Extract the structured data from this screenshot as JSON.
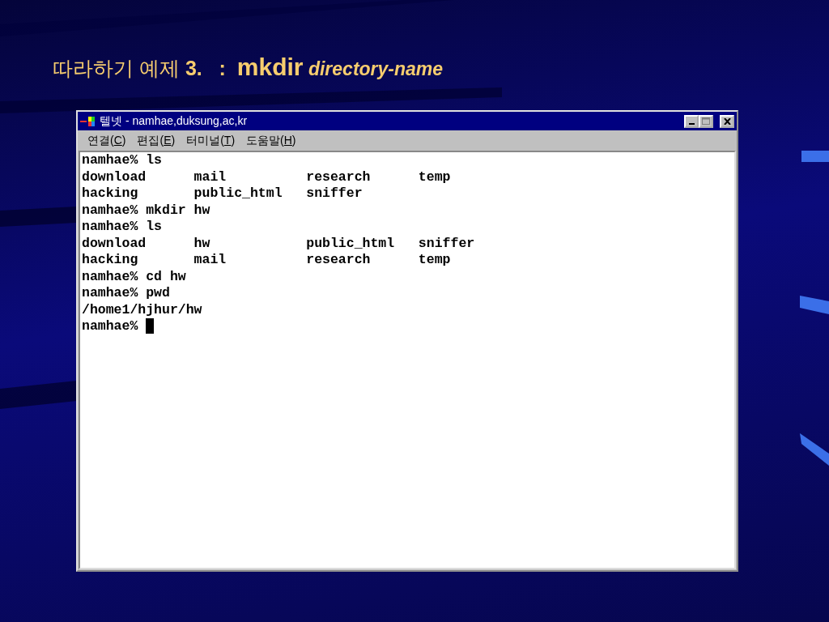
{
  "slide_title": [
    {
      "text": "따라하기 예제 ",
      "kind": "plain"
    },
    {
      "text": "3.   :  ",
      "kind": "bold"
    },
    {
      "text": "mkdir",
      "kind": "command"
    },
    {
      "text": " directory-name",
      "kind": "italic"
    }
  ],
  "window": {
    "title": "텔넷 - namhae,duksung,ac,kr",
    "menu": [
      {
        "before": "연결(",
        "key": "C",
        "after": ")"
      },
      {
        "before": "편집(",
        "key": "E",
        "after": ")"
      },
      {
        "before": "터미널(",
        "key": "T",
        "after": ")"
      },
      {
        "before": "도움말(",
        "key": "H",
        "after": ")"
      }
    ],
    "terminal_lines": [
      "namhae% ls",
      "download      mail          research      temp",
      "hacking       public_html   sniffer",
      "namhae% mkdir hw",
      "namhae% ls",
      "download      hw            public_html   sniffer",
      "hacking       mail          research      temp",
      "namhae% cd hw",
      "namhae% pwd",
      "/home1/hjhur/hw",
      "namhae% "
    ],
    "cursor_visible": true
  }
}
